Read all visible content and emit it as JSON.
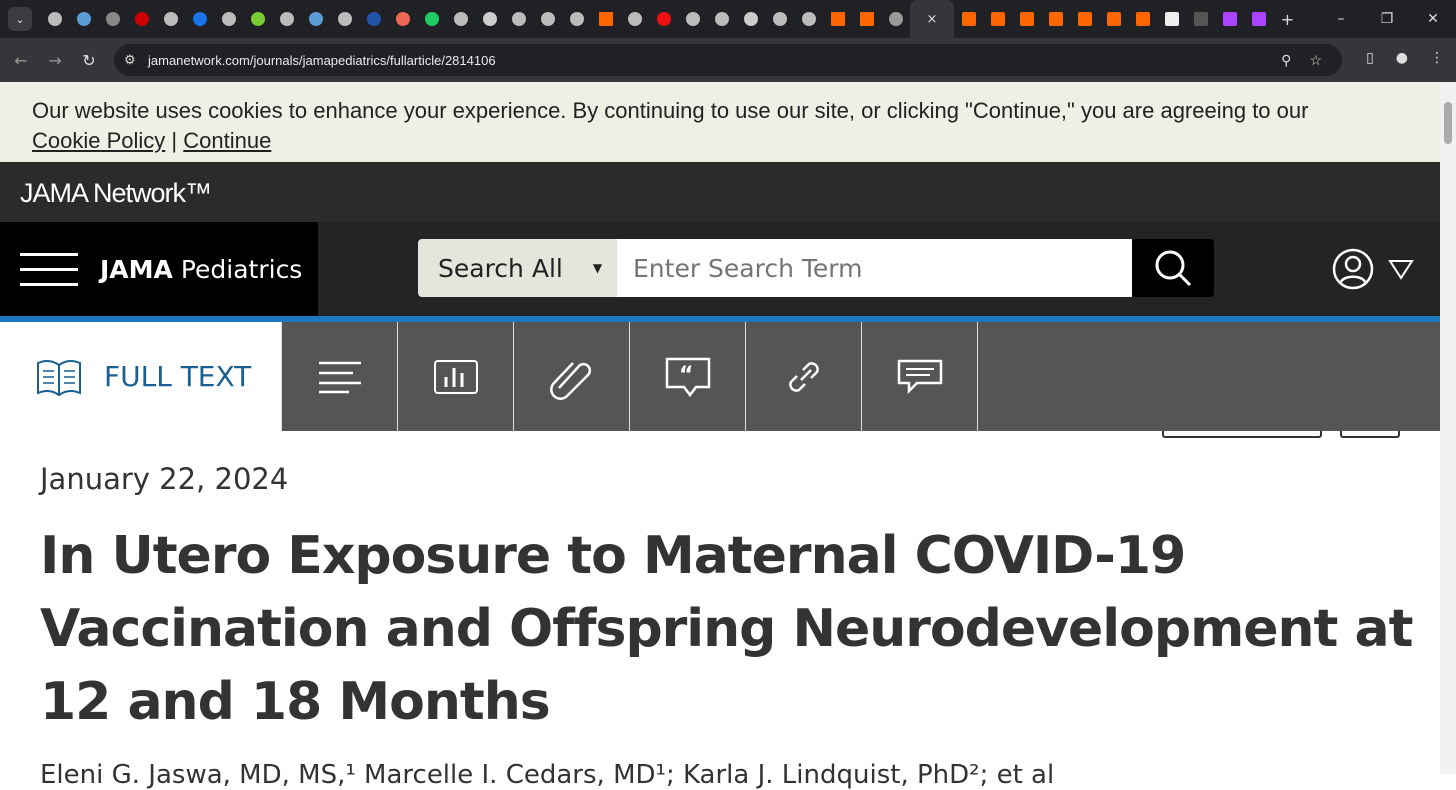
{
  "browser": {
    "url": "jamanetwork.com/journals/jamapediatrics/fullarticle/2814106",
    "tab_count_icons": 38,
    "active_tab_close": "×",
    "new_tab": "+"
  },
  "cookie_banner": {
    "message": "Our website uses cookies to enhance your experience. By continuing to use our site, or clicking \"Continue,\" you are agreeing to our",
    "policy_link": "Cookie Policy",
    "separator": "|",
    "continue_link": "Continue"
  },
  "network": {
    "logo": "JAMA Network™"
  },
  "header": {
    "journal_bold": "JAMA",
    "journal_rest": " Pediatrics",
    "search_scope": "Search All",
    "search_placeholder": "Enter Search Term"
  },
  "toolbar": {
    "full_text_label": "FULL TEXT",
    "icons": [
      "outline-icon",
      "figures-icon",
      "attachment-icon",
      "cite-icon",
      "link-icon",
      "comments-icon"
    ],
    "accent": "#1a5f91"
  },
  "article": {
    "date": "January 22, 2024",
    "title": "In Utero Exposure to Maternal COVID-19 Vaccination and Offspring Neurodevelopment at 12 and 18 Months",
    "authors": "Eleni G. Jaswa, MD, MS,¹ Marcelle I. Cedars, MD¹; Karla J. Lindquist, PhD²; et al"
  }
}
